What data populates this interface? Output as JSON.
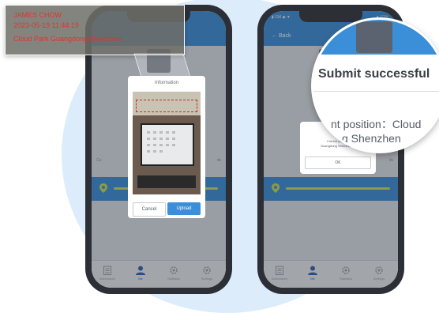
{
  "callout": {
    "name": "JAMES CHOW",
    "datetime": "2023-05-19 11:44:19",
    "location": "Cloud Park Guangdong Shenzhen"
  },
  "left_phone": {
    "dialog_title": "Information",
    "cancel_label": "Cancel",
    "upload_label": "Upload",
    "partial_left_text": "Cu",
    "partial_right_text": "ds"
  },
  "right_phone": {
    "back_label": "← Back",
    "status_left": "▮ GM ◆ ▼",
    "status_right": "▼ 61%",
    "dialog_title": "Sub",
    "message_line1": "Current position ",
    "message_line2": "Guangdong Shenzhen C",
    "ok_label": "OK",
    "partial_right_text": "ds"
  },
  "magnifier": {
    "title": "Submit successful",
    "position_line1": "nt position：Cloud",
    "position_line2": "g Shenzhen"
  },
  "tabbar": {
    "tabs": [
      {
        "label": "Attendance",
        "icon": "clipboard-icon",
        "active": false
      },
      {
        "label": "Me",
        "icon": "person-icon",
        "active": true
      },
      {
        "label": "Statistics",
        "icon": "gear-icon",
        "active": false
      },
      {
        "label": "Settings",
        "icon": "gear-icon",
        "active": false
      }
    ]
  },
  "colors": {
    "accent": "#3a8fd8",
    "callout_text": "#e0342c",
    "active_tab": "#2f5fb5",
    "band_line": "#c9df53"
  }
}
